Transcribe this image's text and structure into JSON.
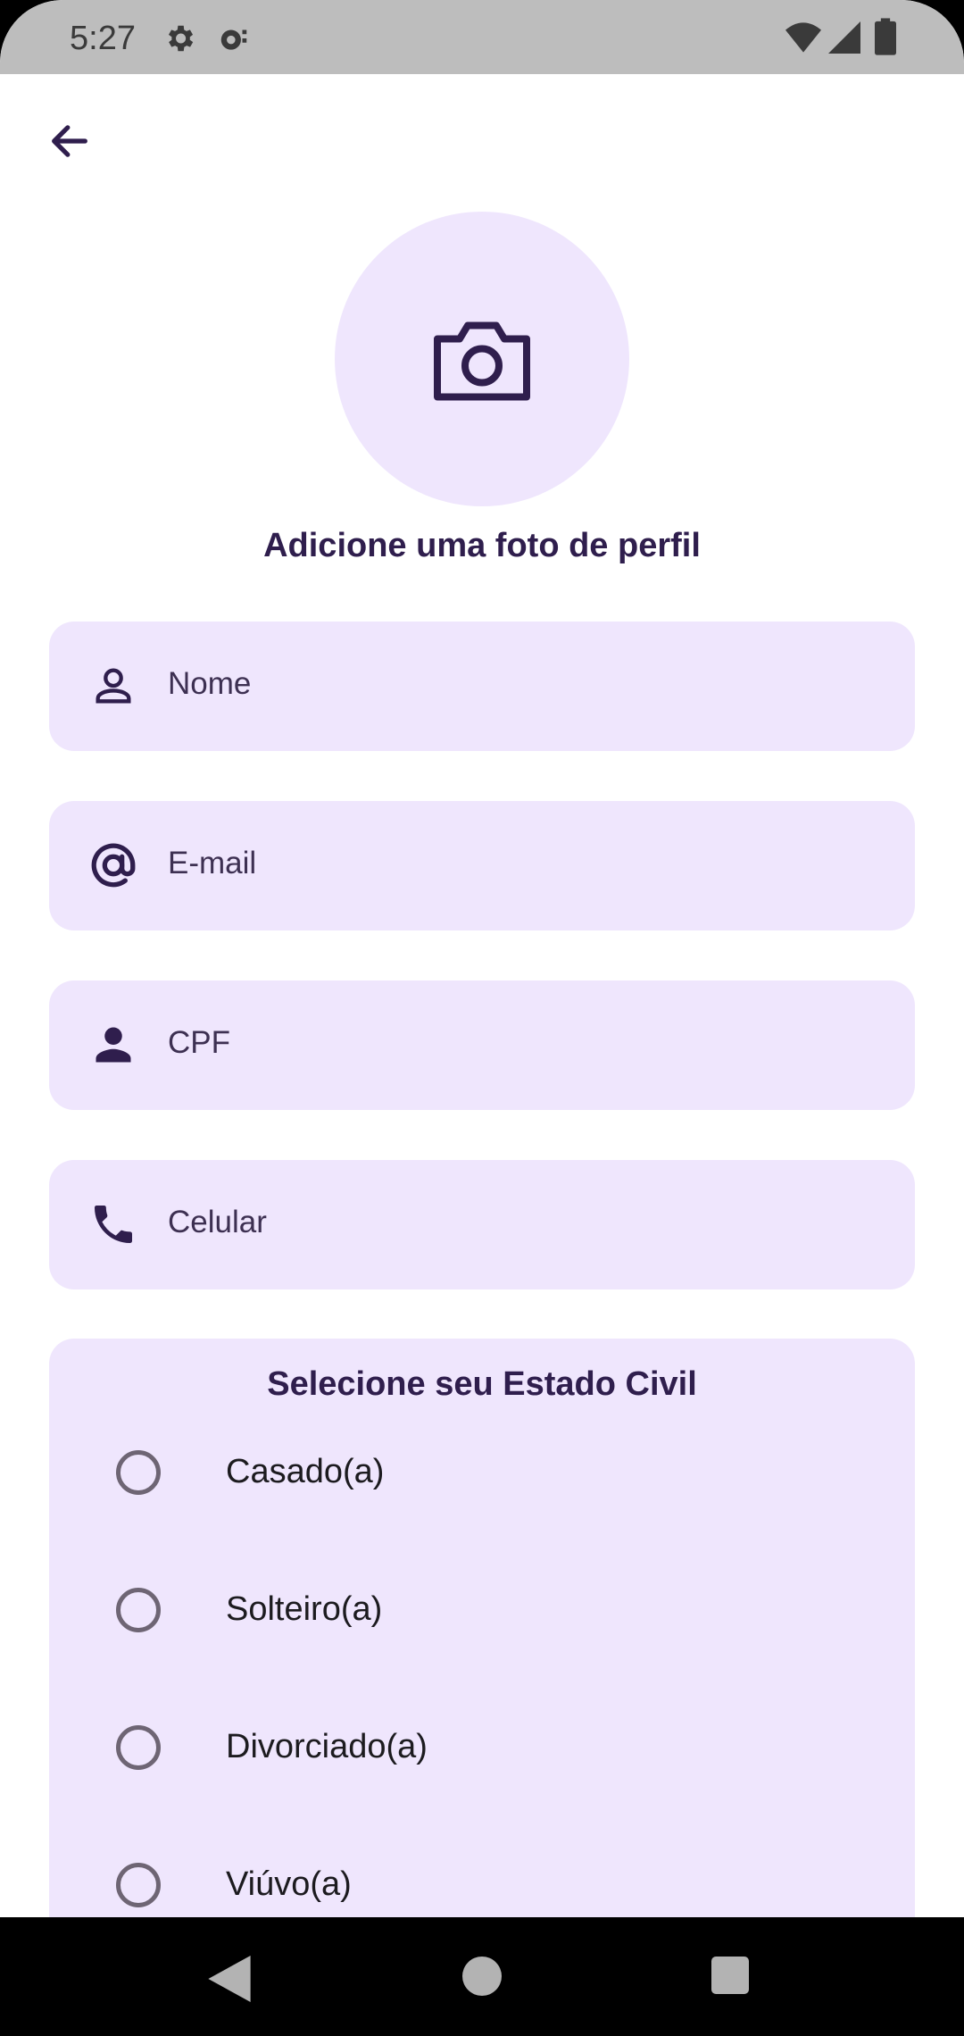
{
  "status_bar": {
    "time": "5:27",
    "icons": [
      "gear-icon",
      "sync-icon",
      "wifi-icon",
      "signal-icon",
      "battery-icon"
    ]
  },
  "header": {
    "back_icon": "arrow-left-icon"
  },
  "profile_photo": {
    "icon": "camera-icon",
    "label": "Adicione uma foto de perfil"
  },
  "form": {
    "fields": [
      {
        "icon": "person-outline-icon",
        "placeholder": "Nome"
      },
      {
        "icon": "at-sign-icon",
        "placeholder": "E-mail"
      },
      {
        "icon": "person-filled-icon",
        "placeholder": "CPF"
      },
      {
        "icon": "phone-icon",
        "placeholder": "Celular"
      }
    ],
    "marital_status": {
      "title": "Selecione seu Estado Civil",
      "options": [
        {
          "label": "Casado(a)",
          "selected": false
        },
        {
          "label": "Solteiro(a)",
          "selected": false
        },
        {
          "label": "Divorciado(a)",
          "selected": false
        },
        {
          "label": "Viúvo(a)",
          "selected": false
        }
      ]
    }
  },
  "nav_bar": {
    "icons": [
      "back-triangle-icon",
      "home-circle-icon",
      "recents-square-icon"
    ]
  },
  "colors": {
    "accent_dark": "#2f1e4d",
    "field_background": "#efe6fd",
    "status_bar": "#bdbdbd"
  }
}
